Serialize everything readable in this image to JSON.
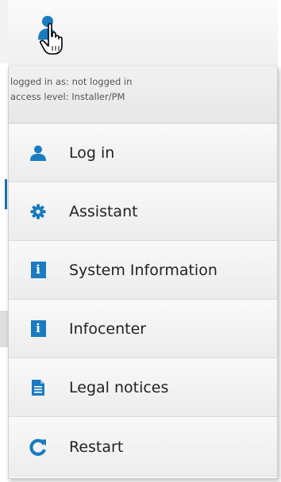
{
  "header": {
    "trigger_icon": "user-pointer-icon"
  },
  "status": {
    "logged_in_text": "logged in as: not logged in",
    "access_level_text": "access level: Installer/PM"
  },
  "menu": {
    "items": [
      {
        "label": "Log in",
        "icon": "user-icon"
      },
      {
        "label": "Assistant",
        "icon": "gear-icon"
      },
      {
        "label": "System Information",
        "icon": "info-icon"
      },
      {
        "label": "Infocenter",
        "icon": "info-icon"
      },
      {
        "label": "Legal notices",
        "icon": "document-icon"
      },
      {
        "label": "Restart",
        "icon": "refresh-icon"
      }
    ]
  },
  "colors": {
    "accent": "#1a7bc0",
    "text": "#222222",
    "status_text": "#555555"
  }
}
